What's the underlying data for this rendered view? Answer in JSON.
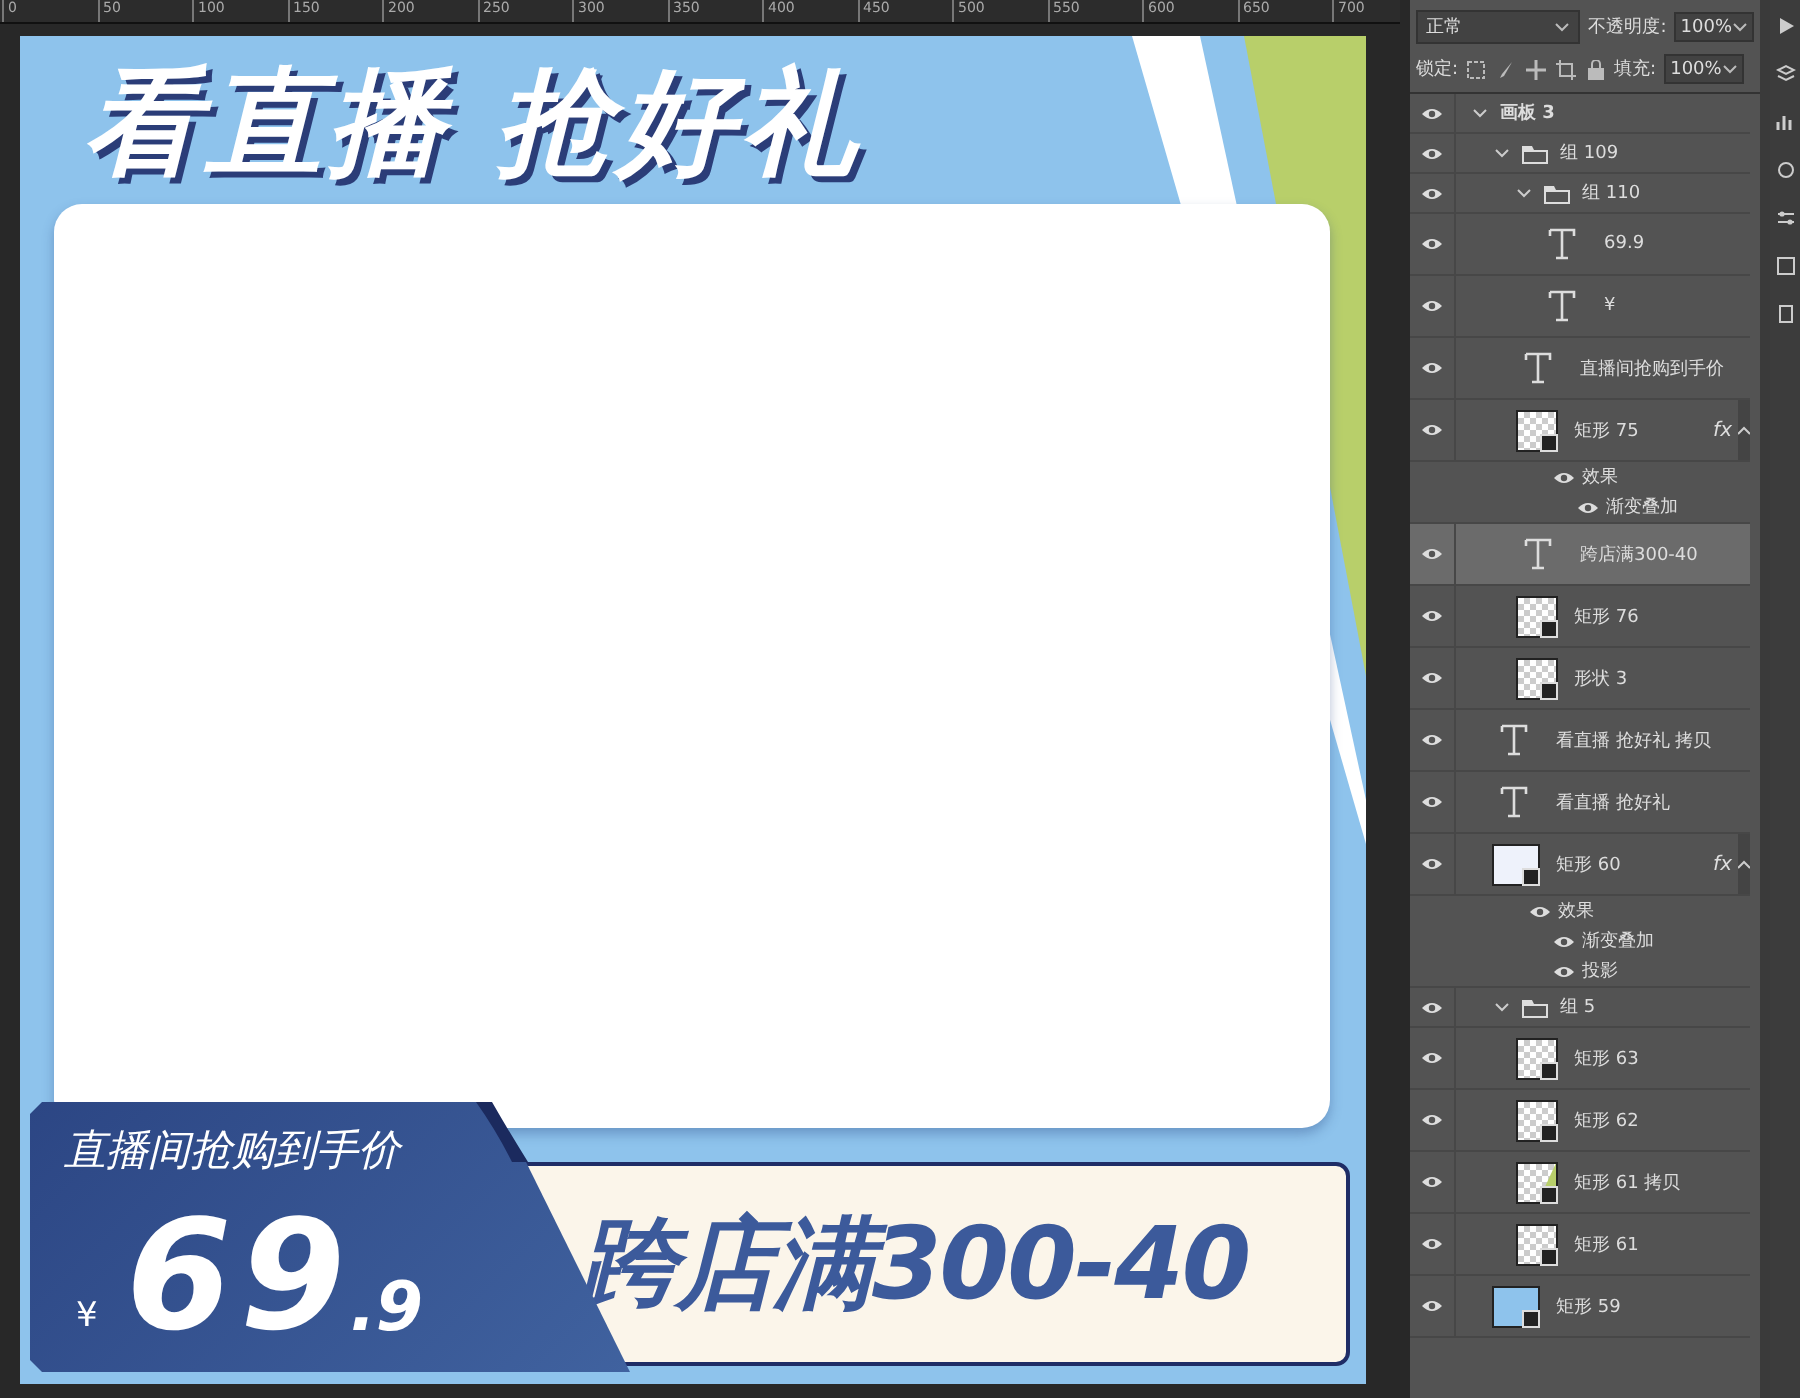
{
  "ruler": {
    "labels": [
      "0",
      "50",
      "100",
      "150",
      "200",
      "250",
      "300",
      "350",
      "400",
      "450",
      "500",
      "550",
      "600",
      "650",
      "700"
    ]
  },
  "artboard": {
    "title": "看直播 抢好礼",
    "price_caption": "直播间抢购到手价",
    "currency": "¥",
    "price_integer": "69",
    "price_decimal": ".9",
    "promo": "跨店满300-40"
  },
  "layers_panel": {
    "blend_mode": "正常",
    "opacity_label": "不透明度:",
    "opacity": "100%",
    "lock_label": "锁定:",
    "fill_label": "填充:",
    "fill": "100%",
    "layers": [
      {
        "kind": "artboard",
        "name": "画板 3",
        "visible": true,
        "expanded": true,
        "selected": false,
        "children": [
          {
            "kind": "group",
            "name": "组 109",
            "visible": true,
            "expanded": true,
            "selected": false,
            "children": [
              {
                "kind": "group",
                "name": "组 110",
                "visible": true,
                "expanded": true,
                "selected": false,
                "children": [
                  {
                    "kind": "text",
                    "name": "69.9",
                    "visible": true,
                    "selected": false
                  },
                  {
                    "kind": "text",
                    "name": "¥",
                    "visible": true,
                    "selected": false
                  }
                ]
              },
              {
                "kind": "text",
                "name": "直播间抢购到手价",
                "visible": true,
                "selected": false
              },
              {
                "kind": "shape",
                "name": "矩形 75",
                "visible": true,
                "selected": false,
                "fx": "fx",
                "effects": {
                  "label": "效果",
                  "items": [
                    "渐变叠加"
                  ]
                }
              },
              {
                "kind": "text",
                "name": "跨店满300-40",
                "visible": true,
                "selected": true
              },
              {
                "kind": "shape",
                "name": "矩形 76",
                "visible": true,
                "selected": false
              },
              {
                "kind": "shape",
                "name": "形状 3",
                "visible": true,
                "selected": false
              }
            ]
          },
          {
            "kind": "text",
            "name": "看直播 抢好礼 拷贝",
            "visible": true,
            "selected": false
          },
          {
            "kind": "text",
            "name": "看直播 抢好礼",
            "visible": true,
            "selected": false
          },
          {
            "kind": "shape",
            "color": "#eef2fb",
            "name": "矩形 60",
            "visible": true,
            "selected": false,
            "fx": "fx",
            "effects": {
              "label": "效果",
              "items": [
                "渐变叠加",
                "投影"
              ]
            }
          },
          {
            "kind": "group",
            "name": "组 5",
            "visible": true,
            "expanded": true,
            "selected": false,
            "children": [
              {
                "kind": "shape",
                "name": "矩形 63",
                "visible": true,
                "selected": false
              },
              {
                "kind": "shape",
                "name": "矩形 62",
                "visible": true,
                "selected": false
              },
              {
                "kind": "shape",
                "color": "#b8cf6a",
                "name": "矩形 61 拷贝",
                "visible": true,
                "selected": false
              },
              {
                "kind": "shape",
                "name": "矩形 61",
                "visible": true,
                "selected": false
              }
            ]
          },
          {
            "kind": "shape",
            "color": "#8ec3ec",
            "name": "矩形 59",
            "visible": true,
            "selected": false
          }
        ]
      }
    ]
  }
}
